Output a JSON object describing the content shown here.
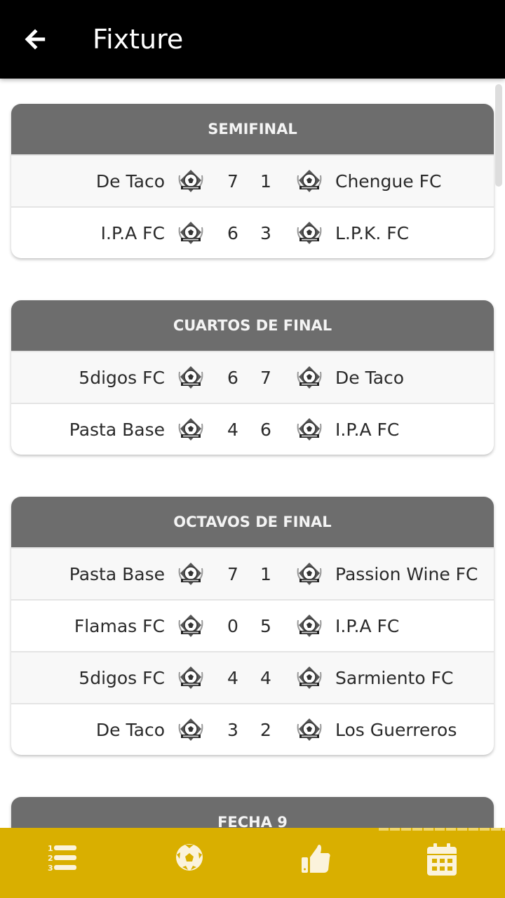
{
  "header": {
    "title": "Fixture",
    "back_icon": "arrow-left-icon"
  },
  "colors": {
    "header_bg": "#000000",
    "nav_bg": "#d9af00",
    "section_bg": "#6d6d6d"
  },
  "sections": [
    {
      "title": "SEMIFINAL",
      "matches": [
        {
          "home": "De Taco",
          "home_score": "7",
          "away_score": "1",
          "away": "Chengue FC"
        },
        {
          "home": "I.P.A FC",
          "home_score": "6",
          "away_score": "3",
          "away": "L.P.K. FC"
        }
      ]
    },
    {
      "title": "CUARTOS DE FINAL",
      "matches": [
        {
          "home": "5digos FC",
          "home_score": "6",
          "away_score": "7",
          "away": "De Taco"
        },
        {
          "home": "Pasta Base",
          "home_score": "4",
          "away_score": "6",
          "away": "I.P.A FC"
        }
      ]
    },
    {
      "title": "OCTAVOS DE FINAL",
      "matches": [
        {
          "home": "Pasta Base",
          "home_score": "7",
          "away_score": "1",
          "away": "Passion Wine FC"
        },
        {
          "home": "Flamas FC",
          "home_score": "0",
          "away_score": "5",
          "away": "I.P.A FC"
        },
        {
          "home": "5digos FC",
          "home_score": "4",
          "away_score": "4",
          "away": "Sarmiento FC"
        },
        {
          "home": "De Taco",
          "home_score": "3",
          "away_score": "2",
          "away": "Los Guerreros"
        }
      ]
    },
    {
      "title": "FECHA 9",
      "matches": []
    }
  ],
  "nav": [
    {
      "icon": "ranking-list-icon"
    },
    {
      "icon": "soccer-ball-icon"
    },
    {
      "icon": "thumbs-up-icon"
    },
    {
      "icon": "calendar-icon",
      "active": true
    }
  ]
}
